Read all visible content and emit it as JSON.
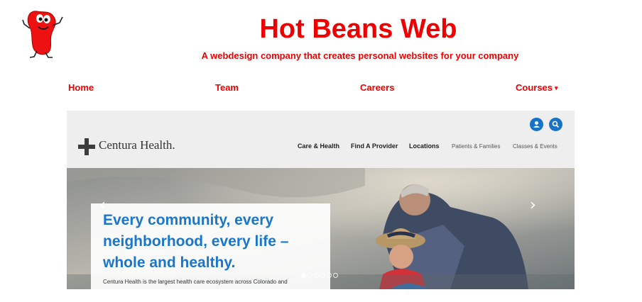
{
  "site": {
    "title": "Hot Beans Web",
    "tagline": "A webdesign company that creates personal websites for your company",
    "brand_color": "#ee0000",
    "logo_icon": "bean-mascot-icon"
  },
  "nav": {
    "items": [
      {
        "label": "Home"
      },
      {
        "label": "Team"
      },
      {
        "label": "Careers"
      },
      {
        "label": "Courses",
        "dropdown": true
      }
    ]
  },
  "screenshot": {
    "brand": "Centura Health.",
    "nav_items": [
      "Care & Health",
      "Find A Provider",
      "Locations",
      "Patients & Families",
      "Classes & Events"
    ],
    "header_icons": [
      "user-icon",
      "search-icon"
    ],
    "headline": "Every community, every neighborhood, every life – whole and healthy.",
    "description": "Centura Health is the largest health care ecosystem across Colorado and",
    "carousel": {
      "slide_count": 6,
      "active_index": 0
    },
    "accent_color": "#1a76c8"
  }
}
